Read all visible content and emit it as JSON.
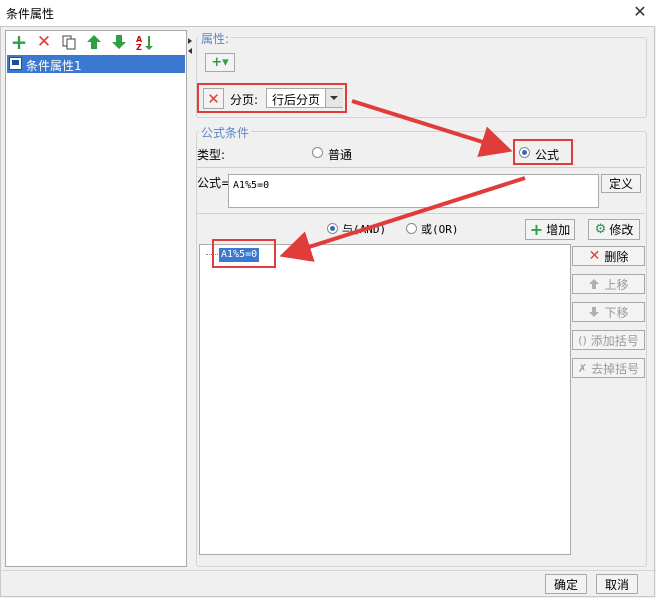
{
  "window": {
    "title": "条件属性",
    "close_glyph": "✕"
  },
  "left_panel": {
    "tree_items": [
      {
        "label": "条件属性1"
      }
    ]
  },
  "properties": {
    "legend": "属性:",
    "add_glyph": "+▾",
    "paging": {
      "label": "分页:",
      "value": "行后分页"
    }
  },
  "formula_condition": {
    "legend": "公式条件",
    "type_label": "类型:",
    "type_options": {
      "normal": "普通",
      "formula": "公式"
    },
    "formula_label": "公式=",
    "formula_value": "A1%5=0",
    "define_button": "定义",
    "logic": {
      "and": "与(AND)",
      "or": "或(OR)"
    },
    "add_button": "增加",
    "modify_button": "修改",
    "condition_list": [
      "A1%5=0"
    ],
    "side_buttons": {
      "delete": "删除",
      "move_up": "上移",
      "move_down": "下移",
      "add_brackets": "添加括号",
      "remove_brackets": "去掉括号"
    }
  },
  "footer": {
    "ok": "确定",
    "cancel": "取消"
  },
  "colors": {
    "accent_red": "#e03c3c",
    "selection": "#3b78d0",
    "legend_blue": "#5d88c2",
    "green": "#2ea043"
  }
}
